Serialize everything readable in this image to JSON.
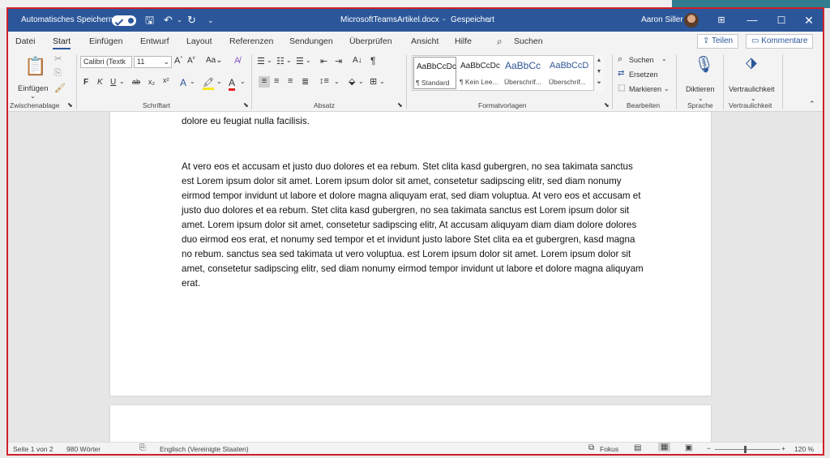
{
  "titlebar": {
    "autosave_label": "Automatisches Speichern",
    "filename": "MicrosoftTeamsArtikel.docx",
    "save_status": "Gespeichert",
    "user": "Aaron Siller"
  },
  "tabs": [
    "Datei",
    "Start",
    "Einfügen",
    "Entwurf",
    "Layout",
    "Referenzen",
    "Sendungen",
    "Überprüfen",
    "Ansicht",
    "Hilfe"
  ],
  "active_tab": "Start",
  "search_label": "Suchen",
  "share_label": "Teilen",
  "comments_label": "Kommentare",
  "ribbon": {
    "clipboard": {
      "paste": "Einfügen",
      "group": "Zwischenablage"
    },
    "font": {
      "name": "Calibri (Textk",
      "size": "11",
      "group": "Schriftart",
      "bold": "F",
      "italic": "K",
      "underline": "U",
      "case": "Aa"
    },
    "paragraph": {
      "group": "Absatz"
    },
    "styles": {
      "group": "Formatvorlagen",
      "items": [
        {
          "sample": "AaBbCcDc",
          "name": "¶ Standard"
        },
        {
          "sample": "AaBbCcDc",
          "name": "¶ Kein Lee..."
        },
        {
          "sample": "AaBbCc",
          "name": "Überschrif..."
        },
        {
          "sample": "AaBbCcD",
          "name": "Überschrif..."
        }
      ]
    },
    "editing": {
      "group": "Bearbeiten",
      "find": "Suchen",
      "replace": "Ersetzen",
      "select": "Markieren"
    },
    "voice": {
      "group": "Sprache",
      "dictate": "Diktieren"
    },
    "sensitivity": {
      "group": "Vertraulichkeit",
      "label": "Vertraulichkeit"
    }
  },
  "document": {
    "line_top": "dolore eu feugiat nulla facilisis.",
    "paragraph": "At vero eos et accusam et justo duo dolores et ea rebum. Stet clita kasd gubergren, no sea takimata sanctus est Lorem ipsum dolor sit amet. Lorem ipsum dolor sit amet, consetetur sadipscing elitr, sed diam nonumy eirmod tempor invidunt ut labore et dolore magna aliquyam erat, sed diam voluptua. At vero eos et accusam et justo duo dolores et ea rebum. Stet clita kasd gubergren, no sea takimata sanctus est Lorem ipsum dolor sit amet. Lorem ipsum dolor sit amet, consetetur sadipscing elitr, At accusam aliquyam diam diam dolore dolores duo eirmod eos erat, et nonumy sed tempor et et invidunt justo labore Stet clita ea et gubergren, kasd magna no rebum. sanctus sea sed takimata ut vero voluptua. est Lorem ipsum dolor sit amet. Lorem ipsum dolor sit amet, consetetur sadipscing elitr, sed diam nonumy eirmod tempor invidunt ut labore et dolore magna aliquyam erat."
  },
  "statusbar": {
    "page": "Seite 1 von 2",
    "words": "980 Wörter",
    "language": "Englisch (Vereinigte Staaten)",
    "focus": "Fokus",
    "zoom": "120 %",
    "zoom_percent": 120
  },
  "colors": {
    "titlebar": "#2b579a",
    "accent": "#2b579a",
    "frame": "#d11f2a"
  },
  "icons": [
    "autosave-toggle",
    "save-icon",
    "undo-icon",
    "redo-icon",
    "customize-icon",
    "ribbon-display-icon",
    "minimize-icon",
    "maximize-icon",
    "close-icon",
    "search-icon",
    "share-icon",
    "comment-icon",
    "paste-icon",
    "cut-icon",
    "copy-icon",
    "format-painter-icon",
    "microphone-icon",
    "sensitivity-icon",
    "focus-icon"
  ]
}
